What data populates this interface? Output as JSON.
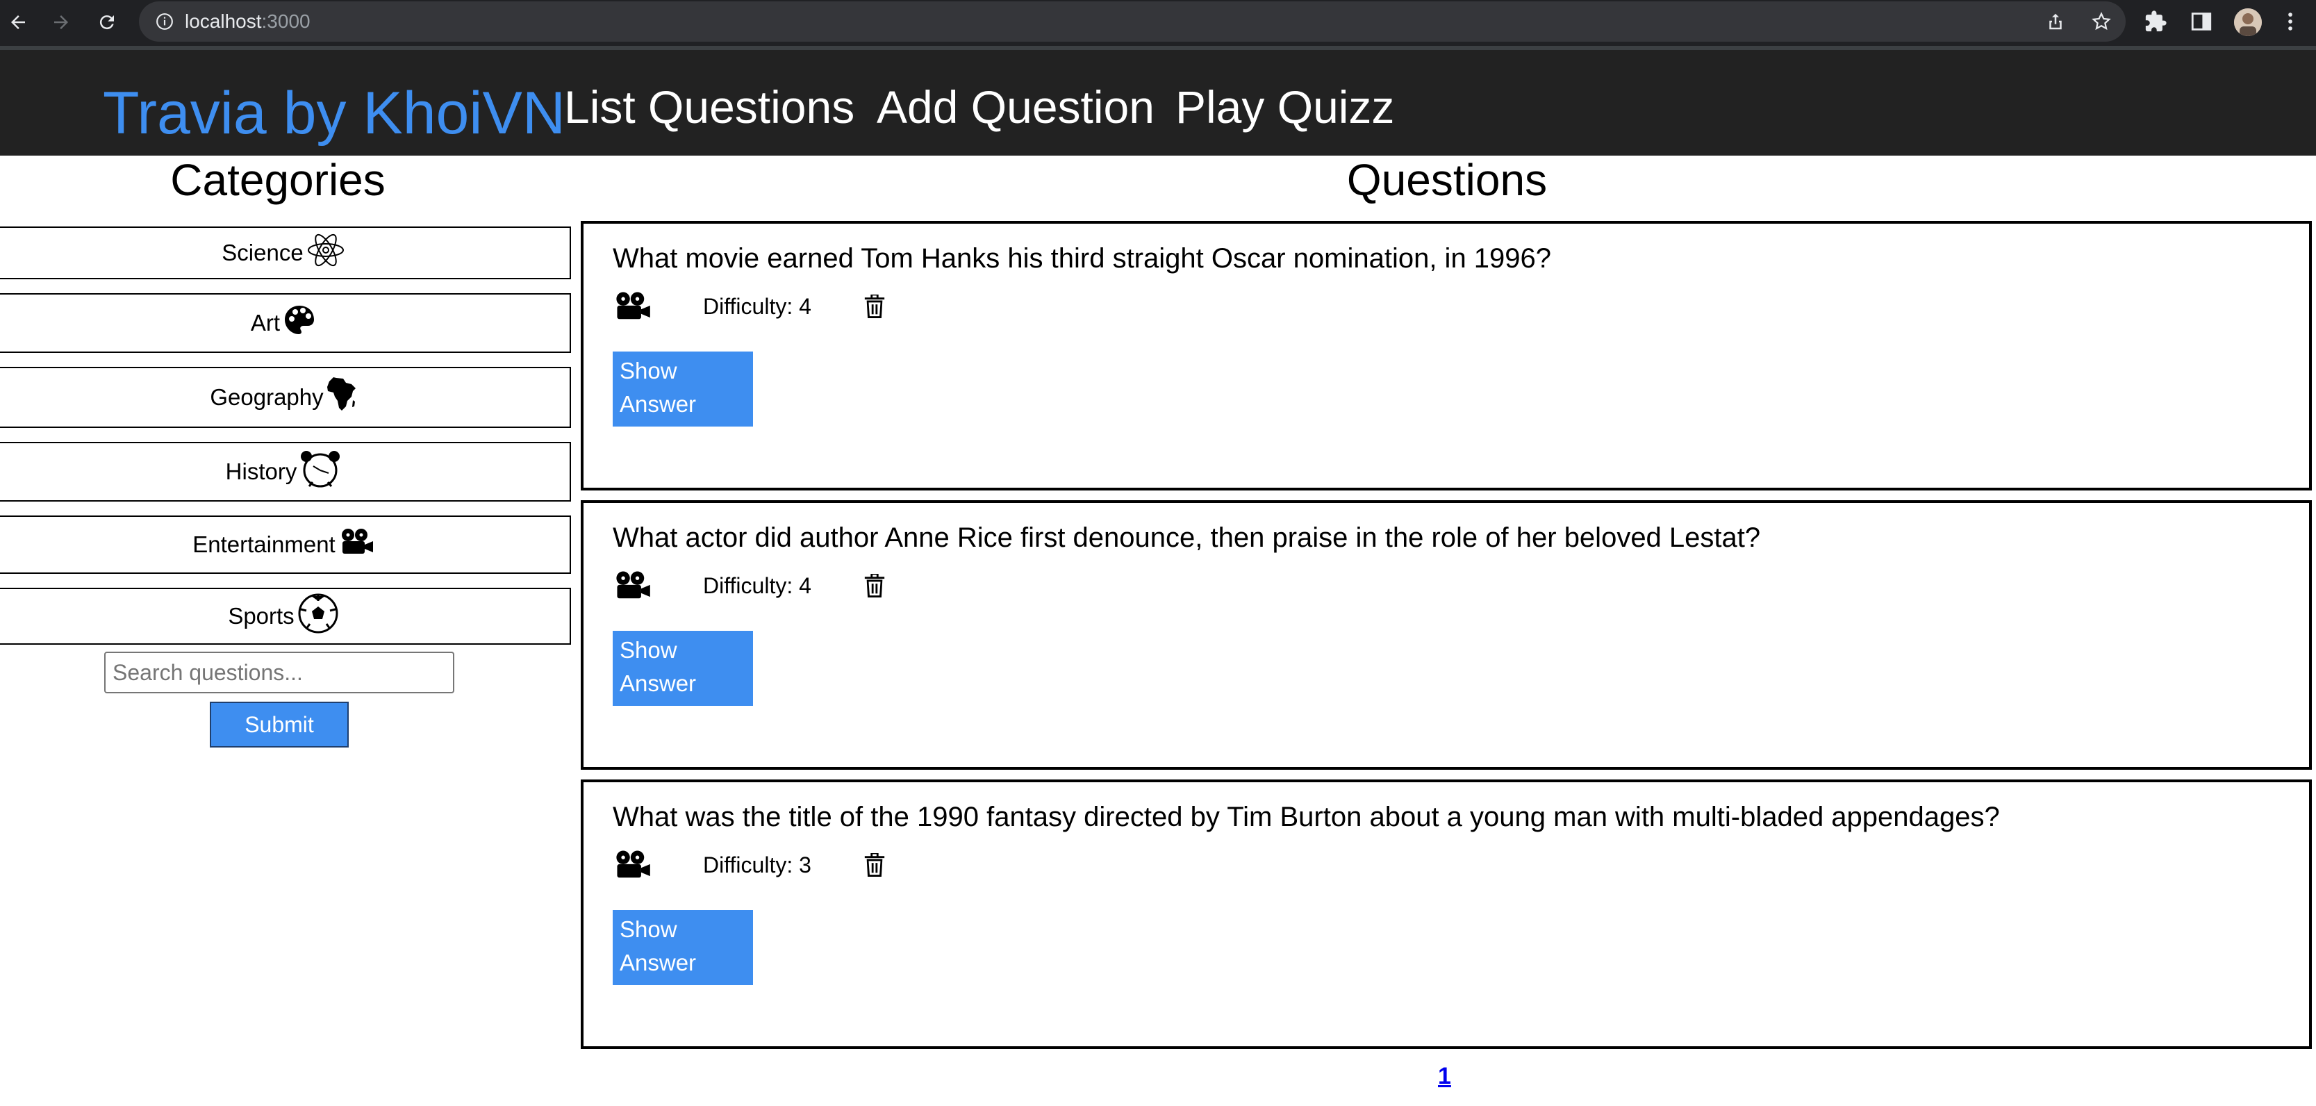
{
  "browser": {
    "url_host": "localhost",
    "url_port": ":3000"
  },
  "header": {
    "brand": "Travia by KhoiVN",
    "nav": [
      "List Questions",
      "Add Question",
      "Play Quizz"
    ]
  },
  "sidebar": {
    "title": "Categories",
    "categories": [
      {
        "label": "Science",
        "icon": "science-atom-icon"
      },
      {
        "label": "Art",
        "icon": "art-palette-icon"
      },
      {
        "label": "Geography",
        "icon": "geography-africa-icon"
      },
      {
        "label": "History",
        "icon": "history-clock-icon"
      },
      {
        "label": "Entertainment",
        "icon": "entertainment-projector-icon"
      },
      {
        "label": "Sports",
        "icon": "sports-ball-icon"
      }
    ],
    "search_placeholder": "Search questions...",
    "submit_label": "Submit"
  },
  "main": {
    "title": "Questions",
    "questions": [
      {
        "text": "What movie earned Tom Hanks his third straight Oscar nomination, in 1996?",
        "difficulty": "Difficulty: 4",
        "category_icon": "entertainment-projector-icon",
        "show_answer_line1": "Show",
        "show_answer_line2": "Answer"
      },
      {
        "text": "What actor did author Anne Rice first denounce, then praise in the role of her beloved Lestat?",
        "difficulty": "Difficulty: 4",
        "category_icon": "entertainment-projector-icon",
        "show_answer_line1": "Show",
        "show_answer_line2": "Answer"
      },
      {
        "text": "What was the title of the 1990 fantasy directed by Tim Burton about a young man with multi-bladed appendages?",
        "difficulty": "Difficulty: 3",
        "category_icon": "entertainment-projector-icon",
        "show_answer_line1": "Show",
        "show_answer_line2": "Answer"
      }
    ],
    "pagination": [
      "1"
    ]
  },
  "colors": {
    "accent": "#3e8ef0",
    "header_bg": "#222222",
    "chrome_bg": "#202124"
  }
}
